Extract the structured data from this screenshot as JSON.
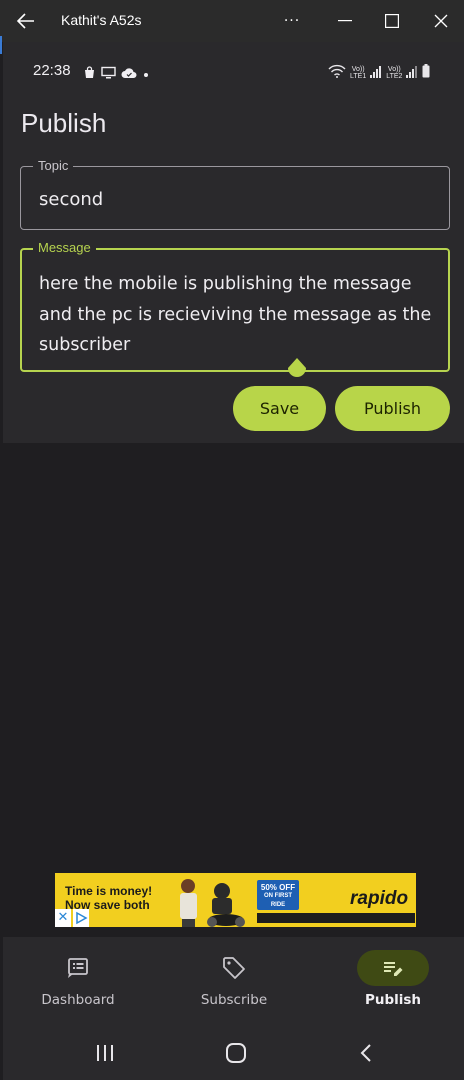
{
  "window": {
    "title": "Kathit's A52s",
    "more_label": "···"
  },
  "status_bar": {
    "time": "22:38",
    "sim1_label_top": "Vo))",
    "sim1_label_bottom": "LTE1",
    "sim2_label_top": "Vo))",
    "sim2_label_bottom": "LTE2"
  },
  "page": {
    "title": "Publish"
  },
  "form": {
    "topic_label": "Topic",
    "topic_value": "second",
    "message_label": "Message",
    "message_value": "here the mobile is publishing the message and the pc is recieviving the message as the subscriber",
    "save_label": "Save",
    "publish_label": "Publish"
  },
  "ad": {
    "headline_line1": "Time is money!",
    "headline_line2": "Now save both",
    "offer_line1": "50% OFF",
    "offer_line2": "ON FIRST RIDE",
    "brand": "rapido",
    "close_label": "✕"
  },
  "bottom_nav": {
    "items": [
      {
        "label": "Dashboard",
        "icon": "dashboard-icon"
      },
      {
        "label": "Subscribe",
        "icon": "tag-icon"
      },
      {
        "label": "Publish",
        "icon": "edit-note-icon",
        "selected": true
      }
    ]
  },
  "colors": {
    "accent": "#b8d549",
    "surface": "#2a292c",
    "background": "#1f1e21",
    "selected_indicator": "#3f4a14"
  }
}
